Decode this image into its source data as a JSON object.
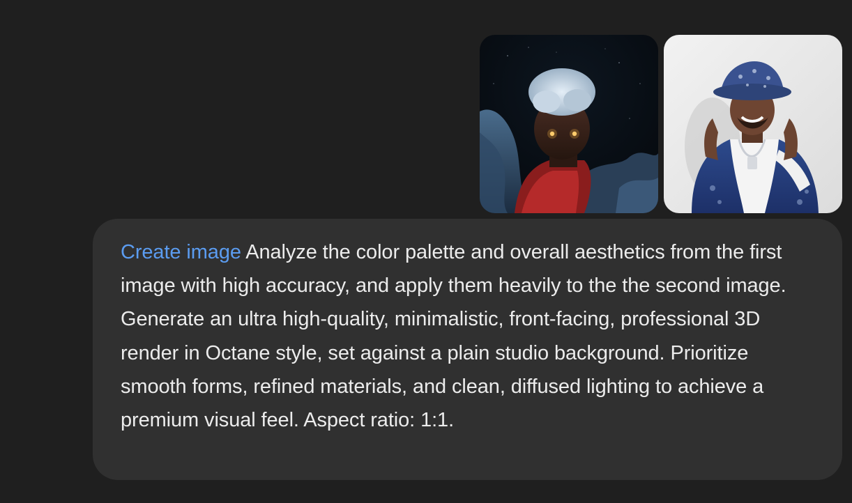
{
  "attachments": [
    {
      "name": "animated-character-image"
    },
    {
      "name": "bucket-hat-man-image"
    }
  ],
  "message": {
    "tool_label": "Create image",
    "text": "Analyze the color palette and overall aesthetics from the first image with high accuracy, and apply them heavily to the the second image. Generate an ultra high-quality, minimalistic, front-facing, professional 3D render in Octane style, set against a plain studio background. Prioritize smooth forms, refined materials, and clean, diffused lighting to achieve a premium visual feel. Aspect ratio: 1:1."
  },
  "colors": {
    "background": "#1f1f1f",
    "bubble": "#303030",
    "text": "#ececec",
    "accent": "#5b9cf0"
  }
}
